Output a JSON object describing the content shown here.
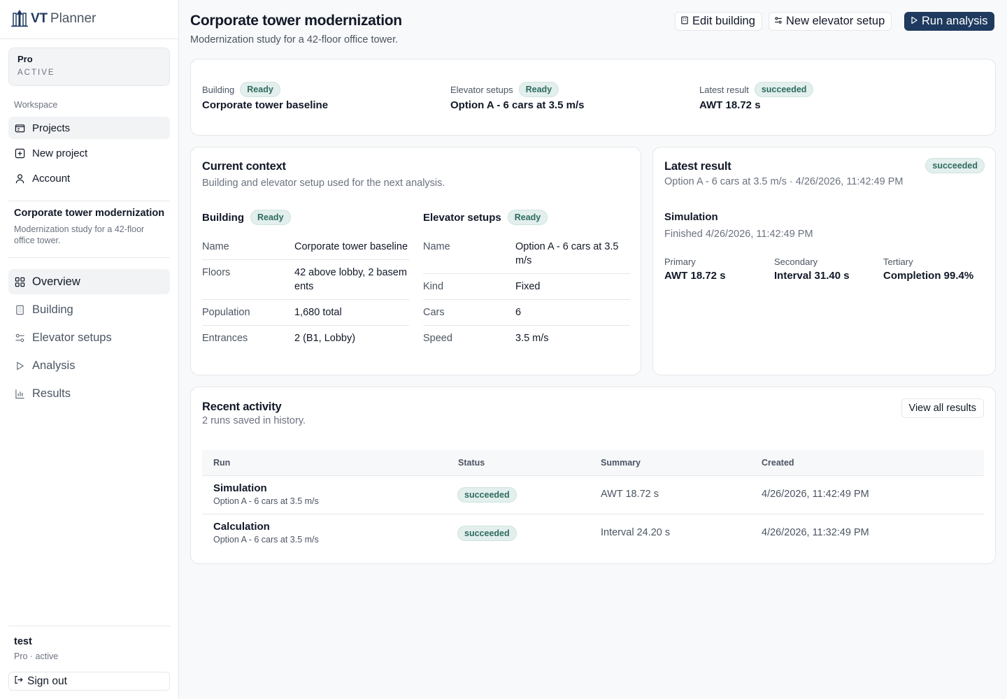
{
  "app": {
    "logo_brand": "VT",
    "logo_product": "Planner",
    "logo_icon": "building-arrow-icon"
  },
  "sidebar": {
    "plan": {
      "name": "Pro",
      "status": "ACTIVE"
    },
    "section_label": "Workspace",
    "workspace_items": [
      {
        "label": "Projects",
        "icon": "folder-icon",
        "active": true
      },
      {
        "label": "New project",
        "icon": "plus-square-icon"
      },
      {
        "label": "Account",
        "icon": "user-icon"
      }
    ],
    "project": {
      "title": "Corporate tower modernization",
      "description": "Modernization study for a 42-floor office tower."
    },
    "project_items": [
      {
        "label": "Overview",
        "icon": "grid-icon",
        "active": true
      },
      {
        "label": "Building",
        "icon": "building-icon"
      },
      {
        "label": "Elevator setups",
        "icon": "sliders-icon"
      },
      {
        "label": "Analysis",
        "icon": "play-icon"
      },
      {
        "label": "Results",
        "icon": "bar-chart-icon"
      }
    ],
    "user": {
      "name": "test",
      "plan": "Pro · active"
    },
    "sign_out_label": "Sign out"
  },
  "header": {
    "title": "Corporate tower modernization",
    "subtitle": "Modernization study for a 42-floor office tower.",
    "buttons": {
      "edit_building": "Edit building",
      "new_setup": "New elevator setup",
      "run_analysis": "Run analysis"
    }
  },
  "summary": {
    "building": {
      "label": "Building",
      "badge": "Ready",
      "value": "Corporate tower baseline"
    },
    "elevator": {
      "label": "Elevator setups",
      "badge": "Ready",
      "value": "Option A - 6 cars at 3.5 m/s"
    },
    "latest": {
      "label": "Latest result",
      "badge": "succeeded",
      "value": "AWT 18.72 s"
    }
  },
  "context": {
    "title": "Current context",
    "subtitle": "Building and elevator setup used for the next analysis.",
    "building": {
      "heading": "Building",
      "badge": "Ready",
      "rows": [
        {
          "key": "Name",
          "value": "Corporate tower baseline"
        },
        {
          "key": "Floors",
          "value": "42 above lobby, 2 basements"
        },
        {
          "key": "Population",
          "value": "1,680 total"
        },
        {
          "key": "Entrances",
          "value": "2 (B1, Lobby)"
        }
      ]
    },
    "elevator": {
      "heading": "Elevator setups",
      "badge": "Ready",
      "rows": [
        {
          "key": "Name",
          "value": "Option A - 6 cars at 3.5 m/s"
        },
        {
          "key": "Kind",
          "value": "Fixed"
        },
        {
          "key": "Cars",
          "value": "6"
        },
        {
          "key": "Speed",
          "value": "3.5 m/s"
        }
      ]
    }
  },
  "latest_result": {
    "title": "Latest result",
    "badge": "succeeded",
    "subtitle": "Option A - 6 cars at 3.5 m/s · 4/26/2026, 11:42:49 PM",
    "run_type": "Simulation",
    "finished": "Finished 4/26/2026, 11:42:49 PM",
    "metrics": [
      {
        "label": "Primary",
        "value": "AWT 18.72 s"
      },
      {
        "label": "Secondary",
        "value": "Interval 31.40 s"
      },
      {
        "label": "Tertiary",
        "value": "Completion 99.4%"
      }
    ]
  },
  "activity": {
    "title": "Recent activity",
    "subtitle": "2 runs saved in history.",
    "view_all_label": "View all results",
    "columns": {
      "run": "Run",
      "status": "Status",
      "summary": "Summary",
      "created": "Created"
    },
    "rows": [
      {
        "name": "Simulation",
        "setup": "Option A - 6 cars at 3.5 m/s",
        "status": "succeeded",
        "summary": "AWT 18.72 s",
        "created": "4/26/2026, 11:42:49 PM"
      },
      {
        "name": "Calculation",
        "setup": "Option A - 6 cars at 3.5 m/s",
        "status": "succeeded",
        "summary": "Interval 24.20 s",
        "created": "4/26/2026, 11:32:49 PM"
      }
    ]
  }
}
